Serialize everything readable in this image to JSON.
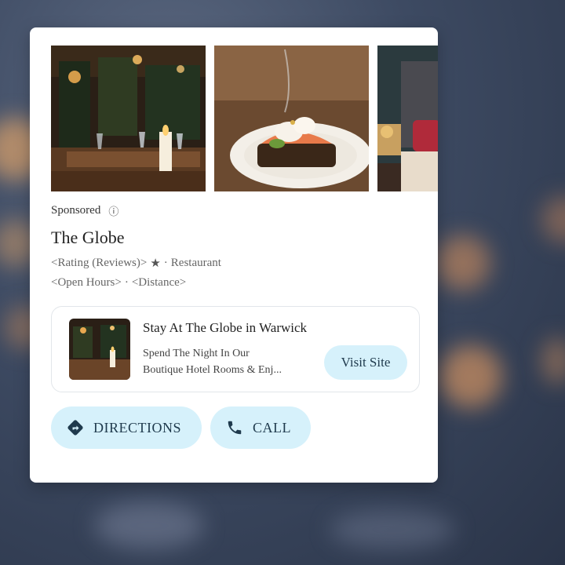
{
  "listing": {
    "sponsored_label": "Sponsored",
    "info_icon": "ⓘ",
    "name": "The Globe",
    "rating_placeholder": "<Rating (Reviews)>",
    "star_icon": "★",
    "separator": "·",
    "category": "Restaurant",
    "hours_placeholder": "<Open Hours>",
    "hours_separator": "·",
    "distance_placeholder": "<Distance>"
  },
  "photos": [
    {
      "name": "restaurant-dining-room-photo"
    },
    {
      "name": "salmon-toast-dish-photo"
    },
    {
      "name": "hotel-bedroom-photo"
    }
  ],
  "promo": {
    "title": "Stay At The Globe in Warwick",
    "desc_line1": "Spend The Night In Our",
    "desc_line2": "Boutique Hotel Rooms & Enj...",
    "visit_label": "Visit Site"
  },
  "actions": {
    "directions_label": "DIRECTIONS",
    "directions_icon": "directions-icon",
    "call_label": "CALL",
    "call_icon": "phone-icon"
  },
  "colors": {
    "button_bg": "#d6f1fb",
    "button_text": "#1f3a4d",
    "card_bg": "#ffffff"
  }
}
